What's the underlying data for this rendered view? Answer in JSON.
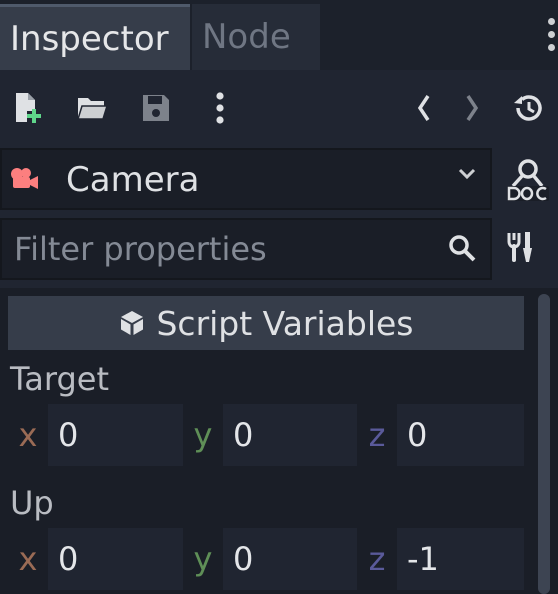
{
  "tabs": [
    {
      "label": "Inspector",
      "active": true
    },
    {
      "label": "Node",
      "active": false
    }
  ],
  "toolbar": {
    "icons": [
      "new-resource-icon",
      "open-folder-icon",
      "save-icon",
      "more-icon",
      "back-icon",
      "forward-icon",
      "history-icon"
    ]
  },
  "object": {
    "name": "Camera",
    "icon": "camera-icon",
    "icon_color": "#fc7f7f"
  },
  "filter": {
    "placeholder": "Filter properties",
    "value": ""
  },
  "section": {
    "title": "Script Variables"
  },
  "properties": [
    {
      "label": "Target",
      "x": "0",
      "y": "0",
      "z": "0"
    },
    {
      "label": "Up",
      "x": "0",
      "y": "0",
      "z": "-1"
    }
  ],
  "axis_labels": {
    "x": "x",
    "y": "y",
    "z": "z"
  },
  "colors": {
    "accent_green": "#5fd68a",
    "axis_x": "#9a6b55",
    "axis_y": "#5f8f57",
    "axis_z": "#5a5a9a"
  }
}
